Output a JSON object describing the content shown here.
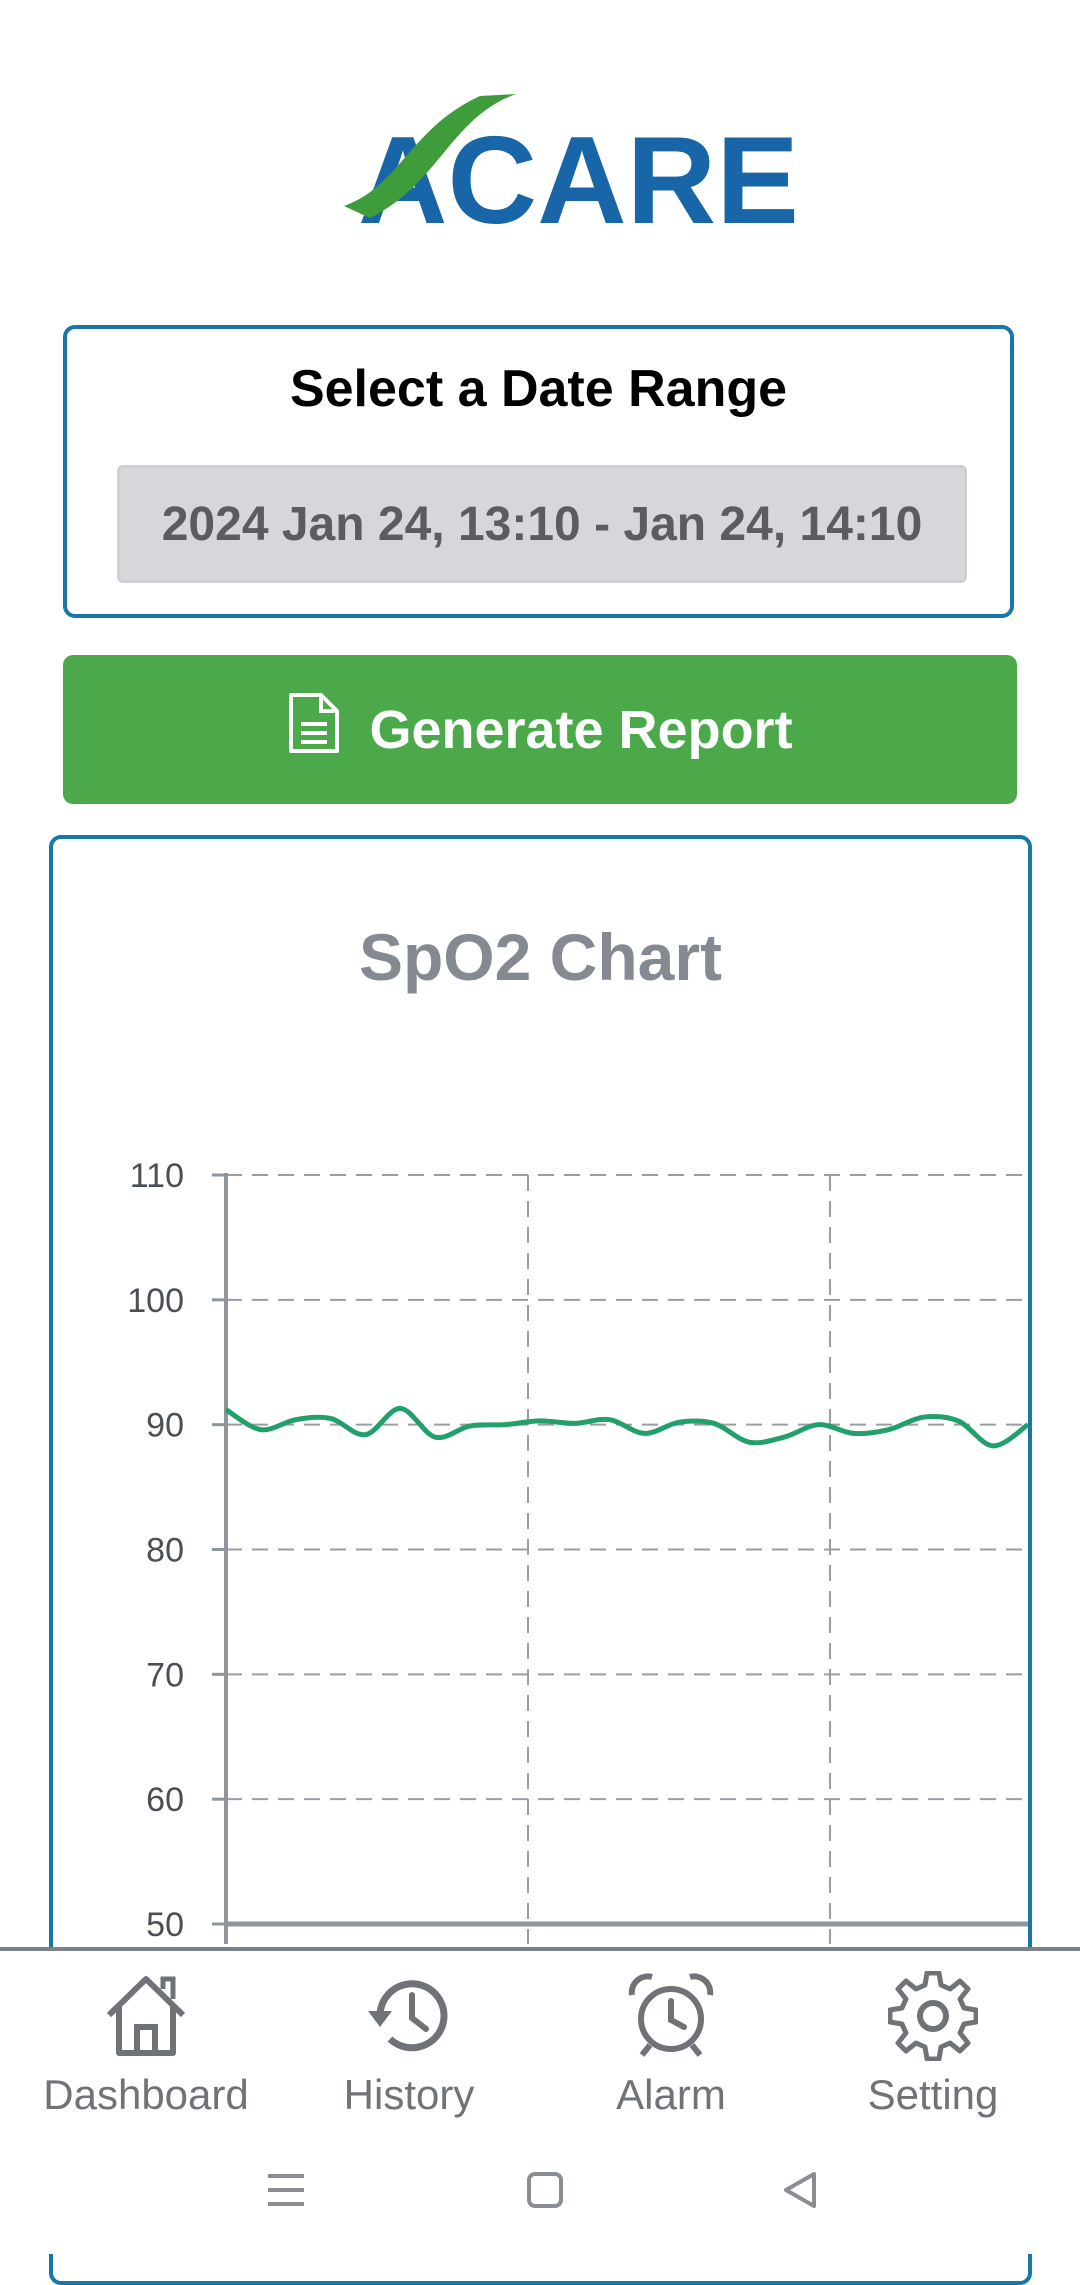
{
  "app": {
    "logo_text": "ACARE"
  },
  "date_range": {
    "title": "Select a Date Range",
    "value": "2024 Jan 24, 13:10 - Jan 24, 14:10"
  },
  "generate_button": {
    "label": "Generate Report",
    "icon": "document-icon"
  },
  "chart": {
    "title": "SpO2 Chart"
  },
  "chart_data": {
    "type": "line",
    "title": "SpO2 Chart",
    "xlabel": "",
    "ylabel": "",
    "ylim": [
      50,
      110
    ],
    "yticks": [
      110,
      100,
      90,
      80,
      70,
      60,
      50
    ],
    "grid": true,
    "series": [
      {
        "values": [
          91.2,
          89.6,
          90.4,
          90.5,
          89.2,
          91.3,
          89.0,
          89.9,
          90.0,
          90.3,
          90.1,
          90.4,
          89.3,
          90.2,
          90.1,
          88.6,
          89.0,
          90.0,
          89.3,
          89.6,
          90.6,
          90.3,
          88.3,
          90.0
        ],
        "color": "#22a06b"
      }
    ],
    "colors": {
      "line": "#22a06b",
      "grid": "#9a9ea3",
      "axis": "#8e969b"
    }
  },
  "nav": [
    {
      "label": "Dashboard",
      "icon": "home-icon"
    },
    {
      "label": "History",
      "icon": "history-icon"
    },
    {
      "label": "Alarm",
      "icon": "alarm-clock-icon"
    },
    {
      "label": "Setting",
      "icon": "gear-icon"
    }
  ],
  "system_nav": {
    "icons": [
      "menu-icon",
      "home-square-icon",
      "back-icon"
    ]
  },
  "colors": {
    "brand_blue": "#1877a6",
    "brand_green": "#4ca94a"
  }
}
